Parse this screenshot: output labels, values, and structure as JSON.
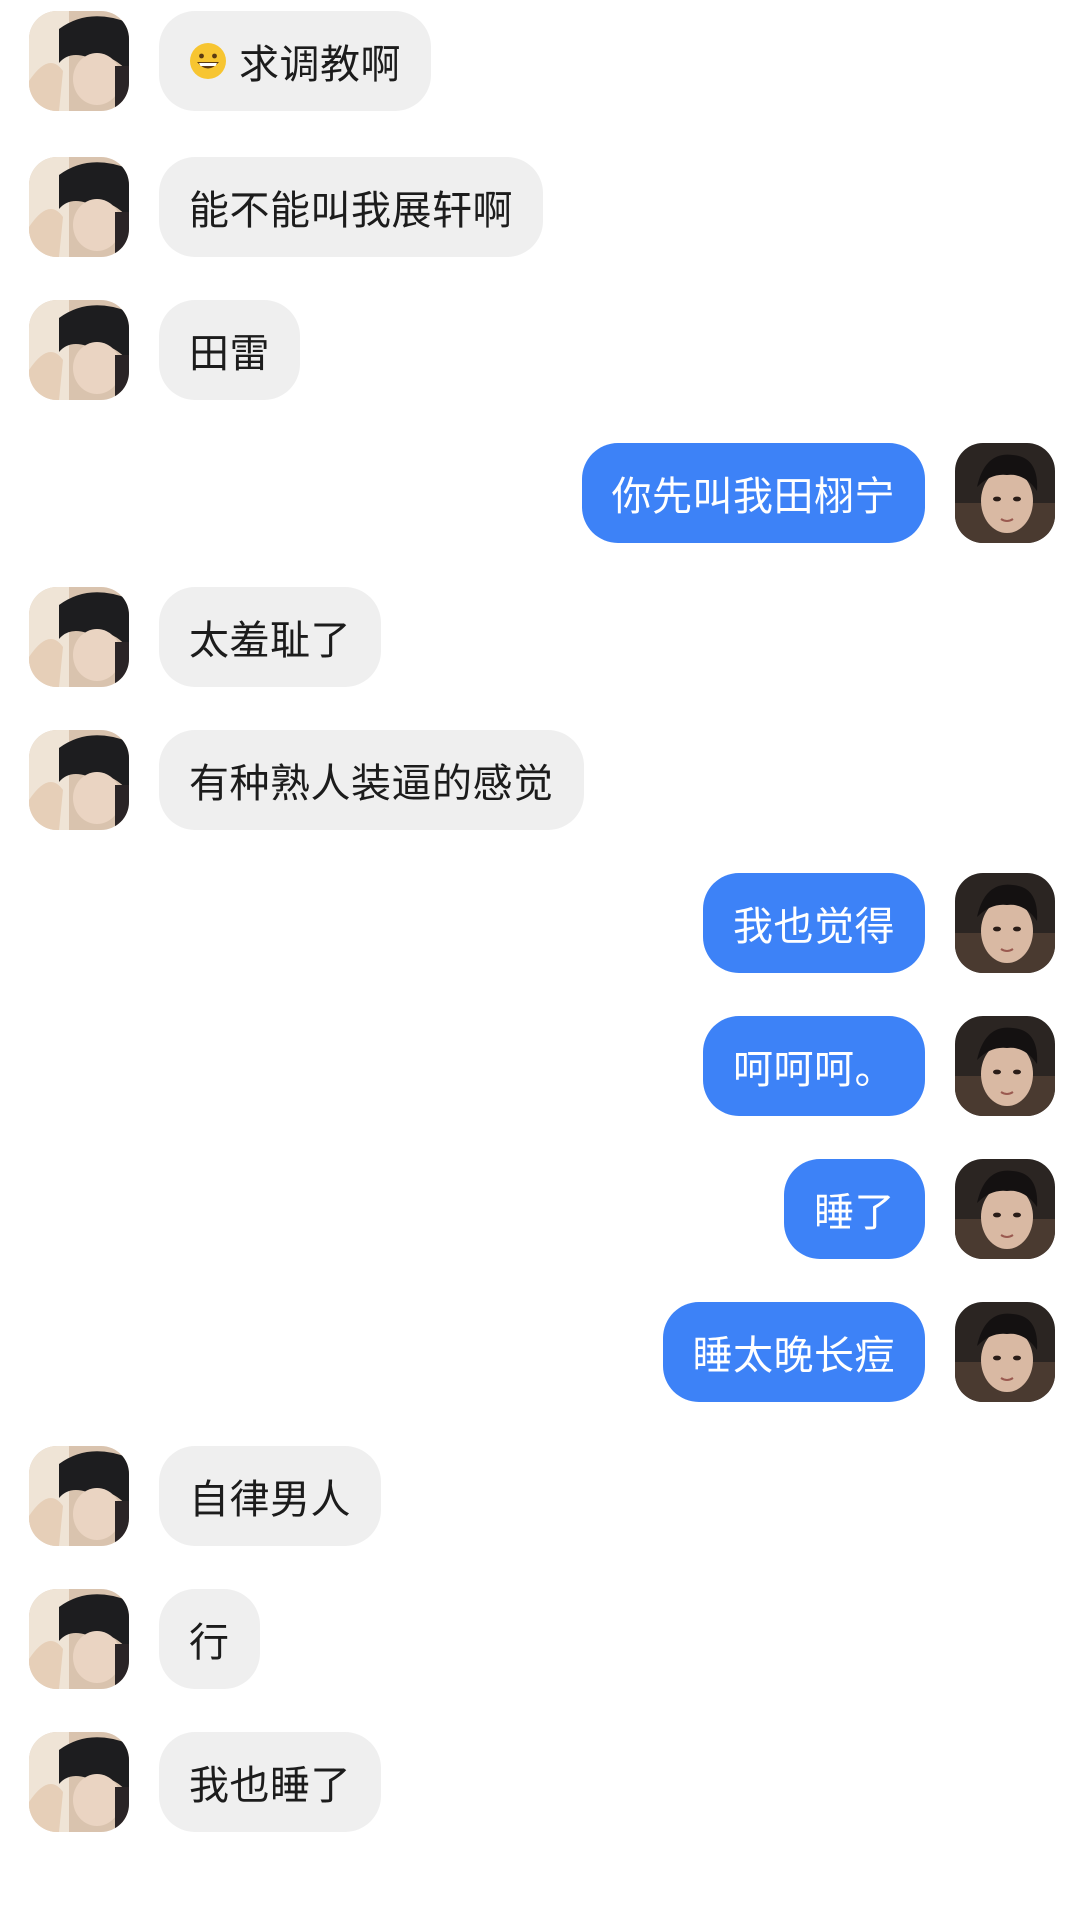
{
  "chat": {
    "messages": [
      {
        "side": "in",
        "text": "求调教啊",
        "emoji": "grinning-face-icon"
      },
      {
        "side": "in",
        "text": "能不能叫我展轩啊"
      },
      {
        "side": "in",
        "text": "田雷"
      },
      {
        "side": "out",
        "text": "你先叫我田栩宁"
      },
      {
        "side": "in",
        "text": "太羞耻了"
      },
      {
        "side": "in",
        "text": "有种熟人装逼的感觉"
      },
      {
        "side": "out",
        "text": "我也觉得"
      },
      {
        "side": "out",
        "text": "呵呵呵。"
      },
      {
        "side": "out",
        "text": "睡了"
      },
      {
        "side": "out",
        "text": "睡太晚长痘"
      },
      {
        "side": "in",
        "text": "自律男人"
      },
      {
        "side": "in",
        "text": "行"
      },
      {
        "side": "in",
        "text": "我也睡了"
      }
    ]
  },
  "colors": {
    "incoming_bubble": "#efefef",
    "outgoing_bubble": "#3d82f7",
    "incoming_text": "#1c1c1c",
    "outgoing_text": "#ffffff"
  }
}
